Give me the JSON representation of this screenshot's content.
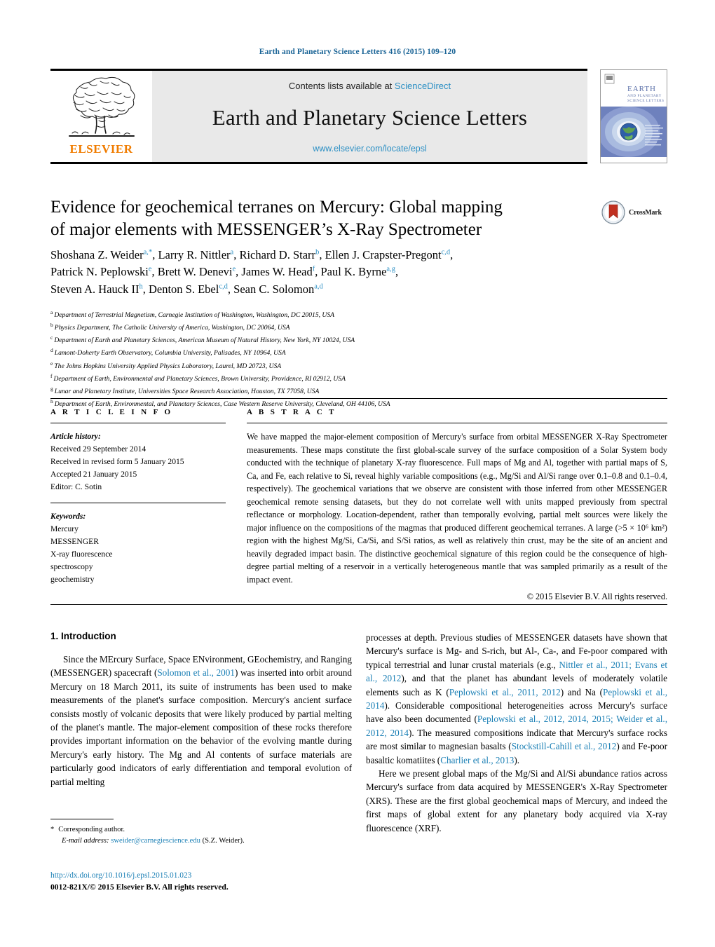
{
  "running_head": "Earth and Planetary Science Letters 416 (2015) 109–120",
  "banner": {
    "contents_prefix": "Contents lists available at",
    "sciencedirect": "ScienceDirect",
    "journal_title": "Earth and Planetary Science Letters",
    "journal_url": "www.elsevier.com/locate/epsl",
    "publisher": "ELSEVIER",
    "cover_title_line1": "EARTH",
    "cover_title_line2": "AND PLANETARY",
    "cover_title_line3": "SCIENCE LETTERS"
  },
  "crossmark": {
    "label": "CrossMark"
  },
  "title": {
    "line1": "Evidence for geochemical terranes on Mercury: Global mapping",
    "line2": "of major elements with MESSENGER’s X-Ray Spectrometer"
  },
  "authors": {
    "line1": "Shoshana Z. Weider ^a,*, Larry R. Nittler ^a, Richard D. Starr ^b, Ellen J. Crapster-Pregont ^c,d,",
    "line2": "Patrick N. Peplowski ^e, Brett W. Denevi ^e, James W. Head ^f, Paul K. Byrne ^a,g,",
    "line3": "Steven A. Hauck II ^h, Denton S. Ebel ^c,d, Sean C. Solomon ^a,d",
    "list": [
      {
        "name": "Shoshana Z. Weider",
        "sup": "a,*"
      },
      {
        "name": "Larry R. Nittler",
        "sup": "a"
      },
      {
        "name": "Richard D. Starr",
        "sup": "b"
      },
      {
        "name": "Ellen J. Crapster-Pregont",
        "sup": "c,d"
      },
      {
        "name": "Patrick N. Peplowski",
        "sup": "e"
      },
      {
        "name": "Brett W. Denevi",
        "sup": "e"
      },
      {
        "name": "James W. Head",
        "sup": "f"
      },
      {
        "name": "Paul K. Byrne",
        "sup": "a,g"
      },
      {
        "name": "Steven A. Hauck II",
        "sup": "h"
      },
      {
        "name": "Denton S. Ebel",
        "sup": "c,d"
      },
      {
        "name": "Sean C. Solomon",
        "sup": "a,d"
      }
    ]
  },
  "affiliations": [
    {
      "key": "a",
      "text": "Department of Terrestrial Magnetism, Carnegie Institution of Washington, Washington, DC 20015, USA"
    },
    {
      "key": "b",
      "text": "Physics Department, The Catholic University of America, Washington, DC 20064, USA"
    },
    {
      "key": "c",
      "text": "Department of Earth and Planetary Sciences, American Museum of Natural History, New York, NY 10024, USA"
    },
    {
      "key": "d",
      "text": "Lamont-Doherty Earth Observatory, Columbia University, Palisades, NY 10964, USA"
    },
    {
      "key": "e",
      "text": "The Johns Hopkins University Applied Physics Laboratory, Laurel, MD 20723, USA"
    },
    {
      "key": "f",
      "text": "Department of Earth, Environmental and Planetary Sciences, Brown University, Providence, RI 02912, USA"
    },
    {
      "key": "g",
      "text": "Lunar and Planetary Institute, Universities Space Research Association, Houston, TX 77058, USA"
    },
    {
      "key": "h",
      "text": "Department of Earth, Environmental, and Planetary Sciences, Case Western Reserve University, Cleveland, OH 44106, USA"
    }
  ],
  "article_info": {
    "heading": "A R T I C L E    I N F O",
    "history_label": "Article history:",
    "history": [
      "Received 29 September 2014",
      "Received in revised form 5 January 2015",
      "Accepted 21 January 2015",
      "Editor: C. Sotin"
    ],
    "keywords_label": "Keywords:",
    "keywords": [
      "Mercury",
      "MESSENGER",
      "X-ray fluorescence",
      "spectroscopy",
      "geochemistry"
    ]
  },
  "abstract": {
    "heading": "A B S T R A C T",
    "text": "We have mapped the major-element composition of Mercury's surface from orbital MESSENGER X-Ray Spectrometer measurements. These maps constitute the first global-scale survey of the surface composition of a Solar System body conducted with the technique of planetary X-ray fluorescence. Full maps of Mg and Al, together with partial maps of S, Ca, and Fe, each relative to Si, reveal highly variable compositions (e.g., Mg/Si and Al/Si range over 0.1–0.8 and 0.1–0.4, respectively). The geochemical variations that we observe are consistent with those inferred from other MESSENGER geochemical remote sensing datasets, but they do not correlate well with units mapped previously from spectral reflectance or morphology. Location-dependent, rather than temporally evolving, partial melt sources were likely the major influence on the compositions of the magmas that produced different geochemical terranes. A large (>5 × 10⁶ km²) region with the highest Mg/Si, Ca/Si, and S/Si ratios, as well as relatively thin crust, may be the site of an ancient and heavily degraded impact basin. The distinctive geochemical signature of this region could be the consequence of high-degree partial melting of a reservoir in a vertically heterogeneous mantle that was sampled primarily as a result of the impact event.",
    "copyright": "© 2015 Elsevier B.V. All rights reserved."
  },
  "section": {
    "number_title": "1. Introduction",
    "left_paragraph": "Since the MErcury Surface, Space ENvironment, GEochemistry, and Ranging (MESSENGER) spacecraft (Solomon et al., 2001) was inserted into orbit around Mercury on 18 March 2011, its suite of instruments has been used to make measurements of the planet's surface composition. Mercury's ancient surface consists mostly of volcanic deposits that were likely produced by partial melting of the planet's mantle. The major-element composition of these rocks therefore provides important information on the behavior of the evolving mantle during Mercury's early history. The Mg and Al contents of surface materials are particularly good indicators of early differentiation and temporal evolution of partial melting",
    "right_paragraph_1": "processes at depth. Previous studies of MESSENGER datasets have shown that Mercury's surface is Mg- and S-rich, but Al-, Ca-, and Fe-poor compared with typical terrestrial and lunar crustal materials (e.g., Nittler et al., 2011; Evans et al., 2012), and that the planet has abundant levels of moderately volatile elements such as K (Peplowski et al., 2011, 2012) and Na (Peplowski et al., 2014). Considerable compositional heterogeneities across Mercury's surface have also been documented (Peplowski et al., 2012, 2014, 2015; Weider et al., 2012, 2014). The measured compositions indicate that Mercury's surface rocks are most similar to magnesian basalts (Stockstill-Cahill et al., 2012) and Fe-poor basaltic komatiites (Charlier et al., 2013).",
    "right_paragraph_2": "Here we present global maps of the Mg/Si and Al/Si abundance ratios across Mercury's surface from data acquired by MESSENGER's X-Ray Spectrometer (XRS). These are the first global geochemical maps of Mercury, and indeed the first maps of global extent for any planetary body acquired via X-ray fluorescence (XRF)."
  },
  "footnote": {
    "star": "*",
    "corresponding": "Corresponding author.",
    "email_label": "E-mail address:",
    "email": "sweider@carnegiescience.edu",
    "email_owner": "(S.Z. Weider)."
  },
  "footer": {
    "doi": "http://dx.doi.org/10.1016/j.epsl.2015.01.023",
    "copyright": "0012-821X/© 2015 Elsevier B.V. All rights reserved."
  },
  "colors": {
    "link_blue": "#1a7fb5",
    "sciencedirect_blue": "#2b8fc4",
    "elsevier_orange": "#F07C00",
    "crossmark_red": "#C03020"
  }
}
